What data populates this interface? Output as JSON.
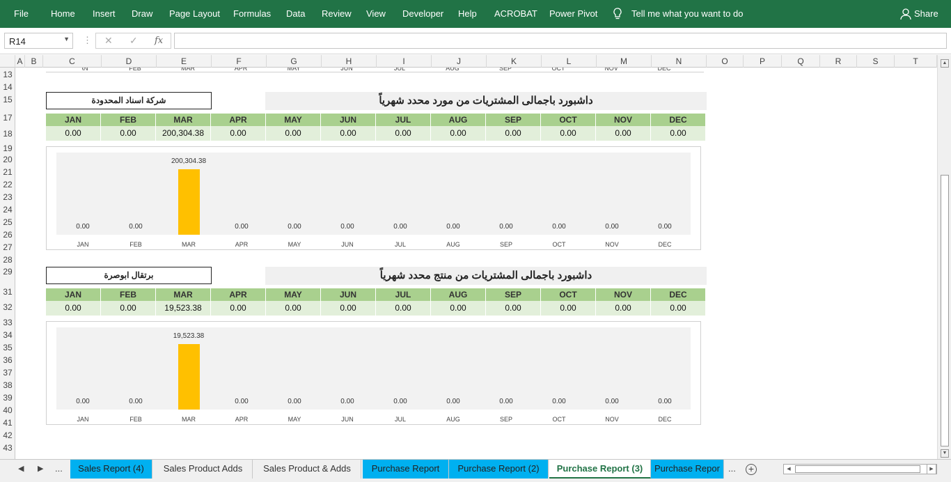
{
  "ribbon": {
    "tabs": [
      "File",
      "Home",
      "Insert",
      "Draw",
      "Page Layout",
      "Formulas",
      "Data",
      "Review",
      "View",
      "Developer",
      "Help",
      "ACROBAT",
      "Power Pivot"
    ],
    "tell_me": "Tell me what you want to do",
    "share": "Share"
  },
  "formula_bar": {
    "name_box": "R14",
    "fx": "fx",
    "cancel": "✕",
    "enter": "✓",
    "value": ""
  },
  "columns": [
    "A",
    "B",
    "C",
    "D",
    "E",
    "F",
    "G",
    "H",
    "I",
    "J",
    "K",
    "L",
    "M",
    "N",
    "O",
    "P",
    "Q",
    "R",
    "S",
    "T"
  ],
  "rows": [
    "13",
    "14",
    "15",
    "17",
    "18",
    "19",
    "20",
    "21",
    "22",
    "23",
    "24",
    "25",
    "26",
    "27",
    "28",
    "29",
    "31",
    "32",
    "33",
    "34",
    "35",
    "36",
    "37",
    "38",
    "39",
    "40",
    "41",
    "42",
    "43"
  ],
  "months": [
    "JAN",
    "FEB",
    "MAR",
    "APR",
    "MAY",
    "JUN",
    "JUL",
    "AUG",
    "SEP",
    "OCT",
    "NOV",
    "DEC"
  ],
  "dashboard1": {
    "selector": "شركة اسناد المحدودة",
    "title": "داشبورد باجمالى المشتريات من مورد محدد شهرياً",
    "values_text": [
      "0.00",
      "0.00",
      "200,304.38",
      "0.00",
      "0.00",
      "0.00",
      "0.00",
      "0.00",
      "0.00",
      "0.00",
      "0.00",
      "0.00"
    ]
  },
  "dashboard2": {
    "selector": "برتقال ابوصرة",
    "title": "داشبورد باجمالى المشتريات من منتج محدد شهرياً",
    "values_text": [
      "0.00",
      "0.00",
      "19,523.38",
      "0.00",
      "0.00",
      "0.00",
      "0.00",
      "0.00",
      "0.00",
      "0.00",
      "0.00",
      "0.00"
    ]
  },
  "chart_data": [
    {
      "type": "bar",
      "categories": [
        "JAN",
        "FEB",
        "MAR",
        "APR",
        "MAY",
        "JUN",
        "JUL",
        "AUG",
        "SEP",
        "OCT",
        "NOV",
        "DEC"
      ],
      "values": [
        0,
        0,
        200304.38,
        0,
        0,
        0,
        0,
        0,
        0,
        0,
        0,
        0
      ],
      "data_labels": [
        "0.00",
        "0.00",
        "200,304.38",
        "0.00",
        "0.00",
        "0.00",
        "0.00",
        "0.00",
        "0.00",
        "0.00",
        "0.00",
        "0.00"
      ],
      "bar_color": "#ffc000",
      "plot_background": "#f2f2f2",
      "grid": false,
      "legend": "none"
    },
    {
      "type": "bar",
      "categories": [
        "JAN",
        "FEB",
        "MAR",
        "APR",
        "MAY",
        "JUN",
        "JUL",
        "AUG",
        "SEP",
        "OCT",
        "NOV",
        "DEC"
      ],
      "values": [
        0,
        0,
        19523.38,
        0,
        0,
        0,
        0,
        0,
        0,
        0,
        0,
        0
      ],
      "data_labels": [
        "0.00",
        "0.00",
        "19,523.38",
        "0.00",
        "0.00",
        "0.00",
        "0.00",
        "0.00",
        "0.00",
        "0.00",
        "0.00",
        "0.00"
      ],
      "bar_color": "#ffc000",
      "plot_background": "#f2f2f2",
      "grid": false,
      "legend": "none"
    }
  ],
  "sheet_nav": {
    "prev": "◀",
    "next": "▶",
    "more_left": "...",
    "more_right": "..."
  },
  "sheet_tabs": [
    {
      "label": "Sales Report (4)",
      "style": "blue"
    },
    {
      "label": "Sales Product Adds",
      "style": "plain"
    },
    {
      "label": "Sales Product & Adds",
      "style": "plain"
    },
    {
      "label": "Purchase Report",
      "style": "blue"
    },
    {
      "label": "Purchase Report (2)",
      "style": "blue"
    },
    {
      "label": "Purchase Report (3)",
      "style": "active"
    },
    {
      "label": "Purchase Repor",
      "style": "blue"
    }
  ],
  "colors": {
    "ribbon": "#217346",
    "header_fill": "#a9d08e",
    "value_fill": "#e2efda",
    "tab_blue": "#00b0f0",
    "bar": "#ffc000"
  }
}
